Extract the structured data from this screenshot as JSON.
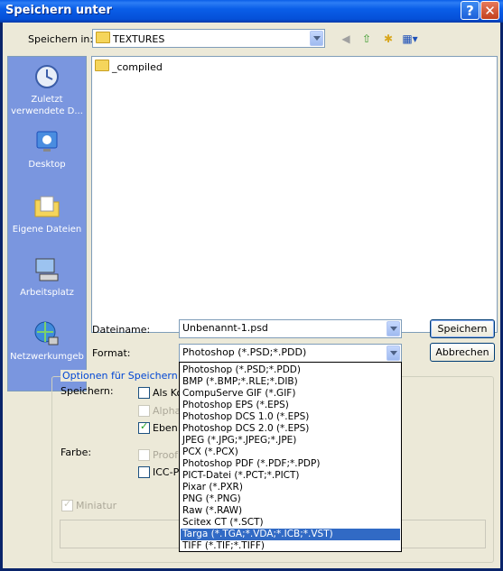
{
  "window": {
    "title": "Speichern unter",
    "help_label": "?",
    "close_label": "✕"
  },
  "toolbar": {
    "save_in_label": "Speichern in:",
    "location": "TEXTURES"
  },
  "places": [
    "Zuletzt verwendete D...",
    "Desktop",
    "Eigene Dateien",
    "Arbeitsplatz",
    "Netzwerkumgeb"
  ],
  "files": [
    "_compiled"
  ],
  "filename": {
    "label": "Dateiname:",
    "value": "Unbenannt-1.psd"
  },
  "format": {
    "label": "Format:",
    "value": "Photoshop (*.PSD;*.PDD)",
    "options": [
      "Photoshop (*.PSD;*.PDD)",
      "BMP (*.BMP;*.RLE;*.DIB)",
      "CompuServe GIF (*.GIF)",
      "Photoshop EPS (*.EPS)",
      "Photoshop DCS 1.0 (*.EPS)",
      "Photoshop DCS 2.0 (*.EPS)",
      "JPEG (*.JPG;*.JPEG;*.JPE)",
      "PCX (*.PCX)",
      "Photoshop PDF (*.PDF;*.PDP)",
      "PICT-Datei (*.PCT;*.PICT)",
      "Pixar (*.PXR)",
      "PNG (*.PNG)",
      "Raw (*.RAW)",
      "Scitex CT (*.SCT)",
      "Targa (*.TGA;*.VDA;*.ICB;*.VST)",
      "TIFF (*.TIF;*.TIFF)"
    ],
    "highlighted": "Targa (*.TGA;*.VDA;*.ICB;*.VST)"
  },
  "buttons": {
    "save": "Speichern",
    "cancel": "Abbrechen"
  },
  "options": {
    "group_title": "Optionen für Speichern",
    "save_label": "Speichern:",
    "as_copy": "Als Ko",
    "alpha": "Alpha",
    "layers": "Eben",
    "color_label": "Farbe:",
    "proof": "Proof",
    "icc": "ICC-P",
    "thumbnail": "Miniatur"
  }
}
